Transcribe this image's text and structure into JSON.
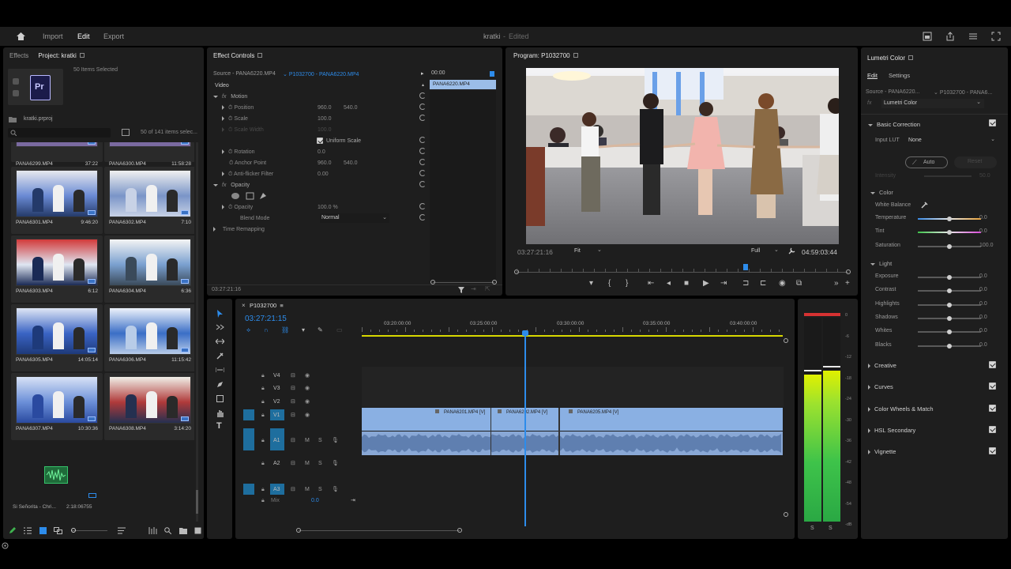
{
  "topbar": {
    "nav": [
      "Import",
      "Edit",
      "Export"
    ],
    "active_nav": "Edit",
    "project_title": "kratki",
    "project_status": "Edited"
  },
  "project_panel": {
    "tabs": [
      "Effects",
      "Project: kratki"
    ],
    "selected_info": "50 Items Selected",
    "file_name": "kratki.prproj",
    "count_info": "50 of 141 items selec...",
    "search_placeholder": "",
    "top_row": [
      {
        "name": "PANA6299.MP4",
        "duration": "37:22"
      },
      {
        "name": "PANA6300.MP4",
        "duration": "11:58:28"
      }
    ],
    "clips": [
      {
        "name": "PANA6301.MP4",
        "duration": "9:46:20"
      },
      {
        "name": "PANA6302.MP4",
        "duration": "7:10"
      },
      {
        "name": "PANA6303.MP4",
        "duration": "6:12"
      },
      {
        "name": "PANA6304.MP4",
        "duration": "6:36"
      },
      {
        "name": "PANA6305.MP4",
        "duration": "14:05:14"
      },
      {
        "name": "PANA6306.MP4",
        "duration": "11:15:42"
      },
      {
        "name": "PANA6307.MP4",
        "duration": "10:30:36"
      },
      {
        "name": "PANA6308.MP4",
        "duration": "3:14:20"
      }
    ],
    "audio_item": {
      "name": "Si Señorita - Chri...",
      "duration": "2:18:06755"
    }
  },
  "effect_controls": {
    "tab": "Effect Controls",
    "source": "Source - PANA6220.MP4",
    "sequence_clip": "P1032700 - PANA6220.MP4",
    "timecode_start": "00:00",
    "clip_label": "PANA6220.MP4",
    "section_video": "Video",
    "motion": "Motion",
    "position_label": "Position",
    "position_x": "960.0",
    "position_y": "540.0",
    "scale_label": "Scale",
    "scale_value": "100.0",
    "scale_width_label": "Scale Width",
    "scale_width_value": "100.0",
    "uniform_scale": "Uniform Scale",
    "rotation_label": "Rotation",
    "rotation_value": "0.0",
    "anchor_label": "Anchor Point",
    "anchor_x": "960.0",
    "anchor_y": "540.0",
    "antiflicker_label": "Anti-flicker Filter",
    "antiflicker_value": "0.00",
    "opacity_section": "Opacity",
    "opacity_label": "Opacity",
    "opacity_value": "100.0 %",
    "blend_label": "Blend Mode",
    "blend_value": "Normal",
    "time_remap": "Time Remapping",
    "current_time": "03:27:21:16"
  },
  "program": {
    "tab": "Program: P1032700",
    "timecode": "03:27:21:16",
    "zoom": "Fit",
    "quality": "Full",
    "duration": "04:59:03:44"
  },
  "timeline": {
    "sequence": "P1032700",
    "timecode": "03:27:21:15",
    "ruler": [
      "03:20:00:00",
      "03:25:00:00",
      "03:30:00:00",
      "03:35:00:00",
      "03:40:00:00"
    ],
    "video_tracks": [
      "V4",
      "V3",
      "V2",
      "V1"
    ],
    "audio_tracks": [
      "A1",
      "A2",
      "A3"
    ],
    "mix_label": "Mix",
    "mix_value": "0.0",
    "clips": [
      "PANA6201.MP4 [V]",
      "PANA6202.MP4 [V]",
      "PANA6205.MP4 [V]"
    ]
  },
  "meter": {
    "scale": [
      "0",
      "-6",
      "-12",
      "-18",
      "-24",
      "-30",
      "-36",
      "-42",
      "-48",
      "-54",
      "-dB"
    ],
    "channels": [
      "S",
      "S"
    ],
    "left_level": 0.72,
    "right_level": 0.74
  },
  "lumetri": {
    "tab": "Lumetri Color",
    "subtabs": [
      "Edit",
      "Settings"
    ],
    "source": "Source - PANA6220...",
    "sequence": "P1032700 - PANA6...",
    "effect": "Lumetri Color",
    "basic_correction": "Basic Correction",
    "input_lut_label": "Input LUT",
    "input_lut_value": "None",
    "auto_label": "Auto",
    "reset_label": "Reset",
    "intensity_label": "Intensity",
    "intensity_value": "50.0",
    "color_section": "Color",
    "white_balance": "White Balance",
    "color_rows": [
      {
        "label": "Temperature",
        "value": "0.0"
      },
      {
        "label": "Tint",
        "value": "0.0"
      },
      {
        "label": "Saturation",
        "value": "100.0"
      }
    ],
    "light_section": "Light",
    "light_rows": [
      {
        "label": "Exposure",
        "value": "0.0"
      },
      {
        "label": "Contrast",
        "value": "0.0"
      },
      {
        "label": "Highlights",
        "value": "0.0"
      },
      {
        "label": "Shadows",
        "value": "0.0"
      },
      {
        "label": "Whites",
        "value": "0.0"
      },
      {
        "label": "Blacks",
        "value": "0.0"
      }
    ],
    "sections": [
      "Creative",
      "Curves",
      "Color Wheels & Match",
      "HSL Secondary",
      "Vignette"
    ]
  },
  "colors": {
    "accent": "#2d8ceb",
    "clip": "#8fb4e6",
    "playhead": "#2d8ceb",
    "track_target": "#1e6e9e"
  }
}
